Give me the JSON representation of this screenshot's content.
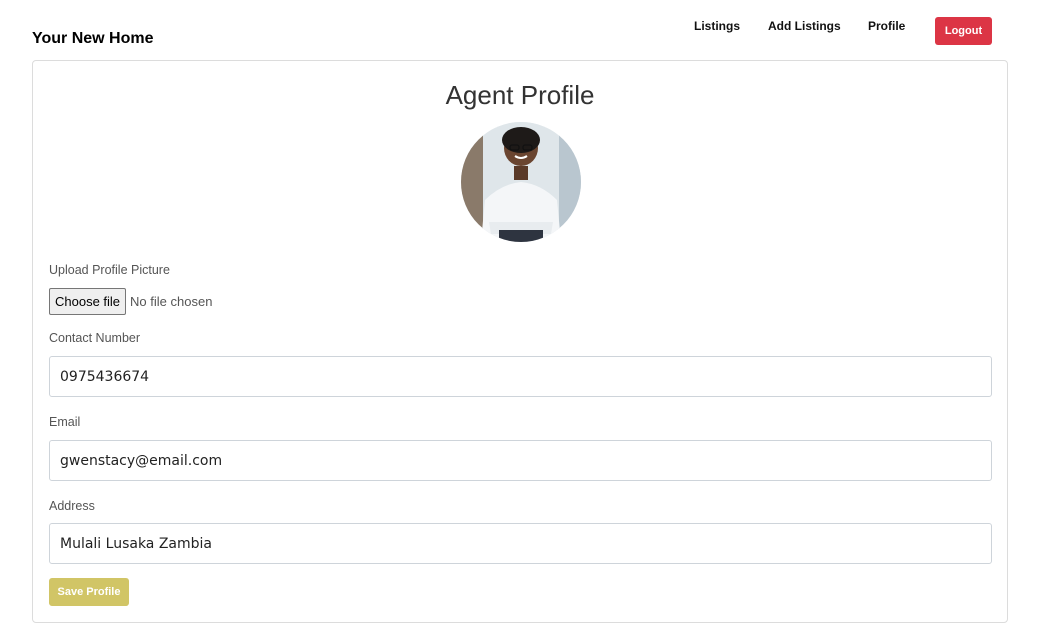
{
  "brand": "Your New Home",
  "nav": {
    "links": [
      "Listings",
      "Add Listings",
      "Profile"
    ],
    "logout_label": "Logout"
  },
  "colors": {
    "logout": "#dc3545",
    "save": "#d1c566"
  },
  "profile": {
    "title": "Agent Profile",
    "upload_label": "Upload Profile Picture",
    "choose_file_label": "Choose file",
    "no_file_text": "No file chosen",
    "contact_label": "Contact Number",
    "contact_value": "0975436674",
    "email_label": "Email",
    "email_value": "gwenstacy@email.com",
    "address_label": "Address",
    "address_value": "Mulali Lusaka Zambia",
    "save_label": "Save Profile"
  }
}
